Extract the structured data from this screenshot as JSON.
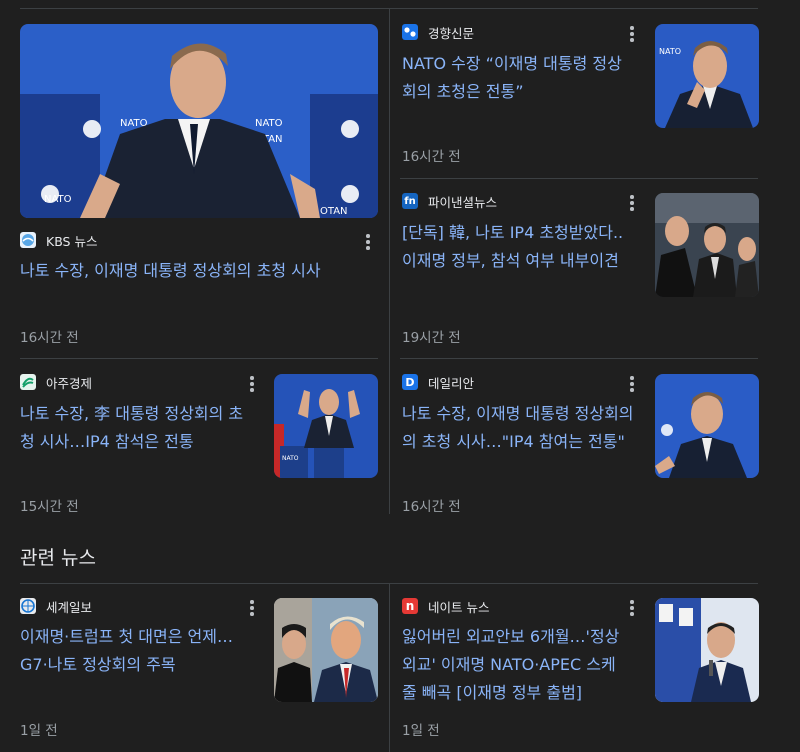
{
  "top_cards": [
    {
      "source": "KBS 뉴스",
      "favicon": "kbs-logo-icon",
      "headline": "나토 수장, 이재명 대통령 정상회의 초청 시사",
      "time": "16시간 전"
    },
    {
      "source": "경향신문",
      "favicon": "kyunghyang-logo-icon",
      "headline": [
        "NATO 수장 “이재명 대통령 정상",
        "회의 초청은 전통”"
      ],
      "time": "16시간 전"
    },
    {
      "source": "파이낸셜뉴스",
      "favicon": "fn-logo-icon",
      "favicon_text": "fn",
      "headline": [
        "[단독] 韓, 나토 IP4 초청받았다..",
        "이재명 정부, 참석 여부 내부이견"
      ],
      "time": "19시간 전"
    },
    {
      "source": "아주경제",
      "favicon": "ajunews-logo-icon",
      "headline": [
        "나토 수장, 李 대통령 정상회의 초",
        "청 시사…IP4 참석은 전통"
      ],
      "time": "15시간 전"
    },
    {
      "source": "데일리안",
      "favicon": "dailian-logo-icon",
      "favicon_text": "D",
      "headline": [
        "나토 수장, 이재명 대통령 정상회의",
        "의 초청 시사…\"IP4 참여는 전통\""
      ],
      "time": "16시간 전"
    }
  ],
  "section_title": "관련 뉴스",
  "related_cards": [
    {
      "source": "세계일보",
      "favicon": "segye-logo-icon",
      "headline": [
        "이재명·트럼프 첫 대면은 언제…",
        "G7·나토 정상회의 주목"
      ],
      "time": "1일 전"
    },
    {
      "source": "네이트 뉴스",
      "favicon": "nate-logo-icon",
      "favicon_text": "n",
      "headline": [
        "잃어버린 외교안보 6개월…'정상",
        "외교' 이재명 NATO·APEC 스케",
        "줄 빼곡 [이재명 정부 출범]"
      ],
      "time": "1일 전"
    }
  ],
  "thumb_text": {
    "nato": "NATO",
    "otan": "OTAN"
  },
  "colors": {
    "background": "#1f1f1f",
    "headline": "#8ab4f8",
    "meta": "#9aa0a6",
    "divider": "#3c4043",
    "source_text": "#e8eaed"
  }
}
